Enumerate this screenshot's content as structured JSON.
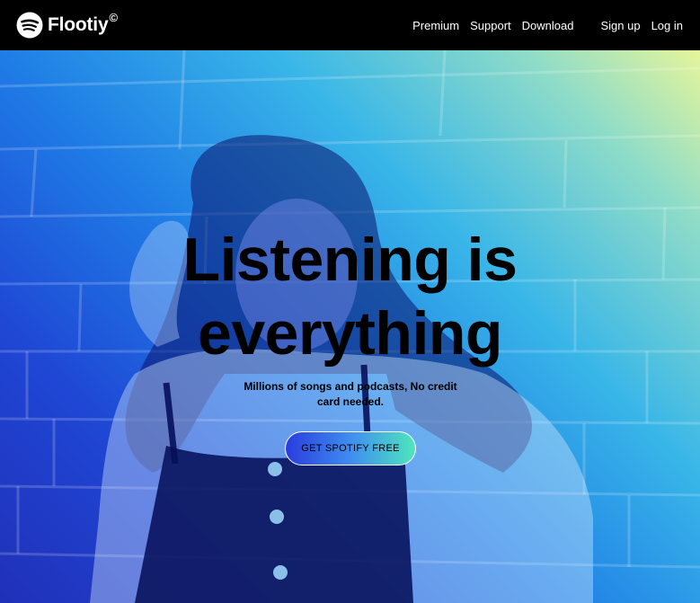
{
  "brand": {
    "name": "Flootiy",
    "mark": "©",
    "icon": "sound-waves-logo-icon"
  },
  "nav": {
    "links": [
      "Premium",
      "Support",
      "Download"
    ],
    "account": [
      "Sign up",
      "Log in"
    ]
  },
  "hero": {
    "title_line1": "Listening is",
    "title_line2": "everything",
    "subtitle_line1": "Millions of songs and podcasts, No credit",
    "subtitle_line2": "card needed.",
    "cta_label": "GET SPOTIFY FREE"
  },
  "colors": {
    "navbar": "#000000",
    "gradient_start": "#e6f59a",
    "gradient_mid": "#39b6e8",
    "gradient_end": "#2030b8",
    "cta_start": "#2a3cde",
    "cta_end": "#4fe6bd"
  }
}
